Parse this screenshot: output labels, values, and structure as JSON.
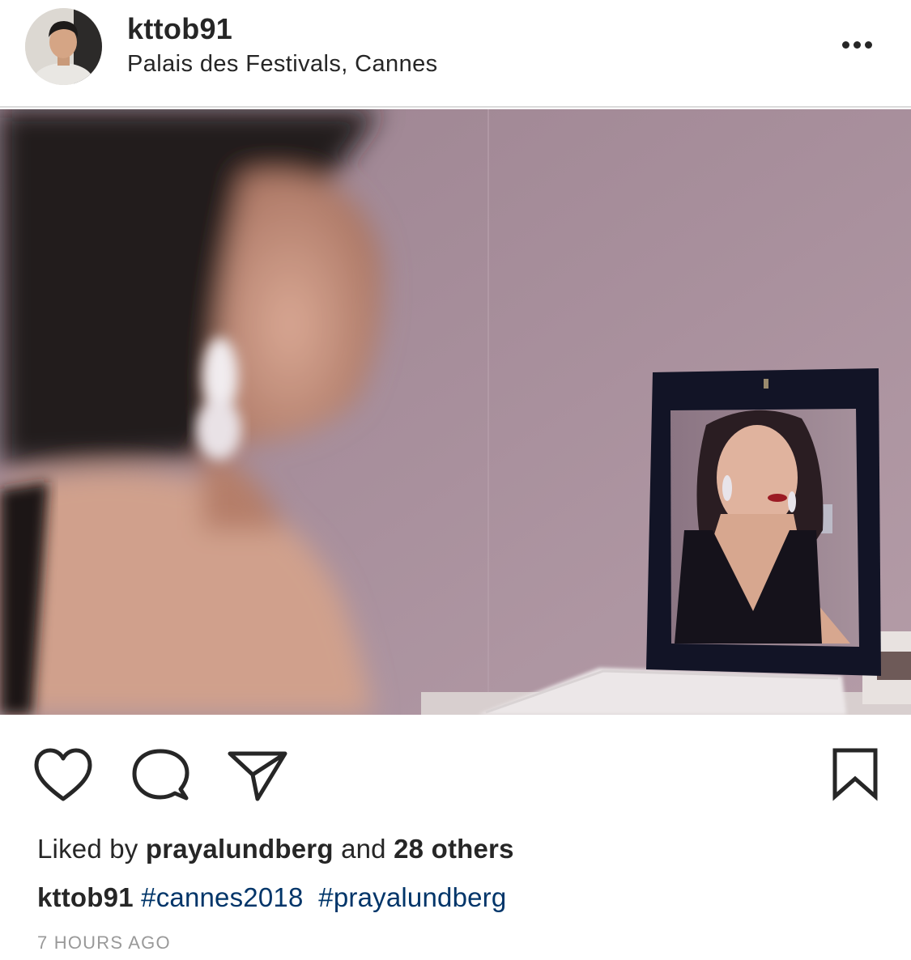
{
  "header": {
    "username": "kttob91",
    "location": "Palais des Festivals, Cannes",
    "more_icon": "more-horizontal-icon"
  },
  "photo": {
    "subject": "post-photo"
  },
  "actions": {
    "like_icon": "heart-icon",
    "comment_icon": "comment-icon",
    "share_icon": "paper-plane-icon",
    "save_icon": "bookmark-icon"
  },
  "likes": {
    "prefix": "Liked by",
    "user": "prayalundberg",
    "connector": "and",
    "others": "28 others"
  },
  "caption": {
    "username": "kttob91",
    "hashtags": [
      "#cannes2018",
      "#prayalundberg"
    ]
  },
  "timestamp": "7 HOURS AGO",
  "colors": {
    "text": "#262626",
    "hashtag": "#003569",
    "muted": "#999999",
    "divider": "#dbdbdb"
  }
}
